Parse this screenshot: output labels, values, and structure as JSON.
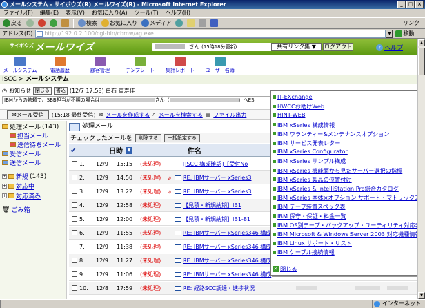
{
  "window": {
    "title": "メールシステム - サイボウズ(R) メールワイズ(R) - Microsoft Internet Explorer",
    "menus": [
      "ファイル(F)",
      "編集(E)",
      "表示(V)",
      "お気に入り(A)",
      "ツール(T)",
      "ヘルプ(H)"
    ],
    "toolbar": {
      "back": "戻る",
      "search": "検索",
      "favorites": "お気に入り",
      "media": "メディア"
    },
    "address_label": "アドレス(D)",
    "address_value": "http://192.0.2.100/cgi-bin/cbmw/ag.exe",
    "go_label": "移動",
    "links_label": "リンク"
  },
  "header": {
    "logo_small": "サイボウズ",
    "logo_big": "メールワイズ",
    "user_suffix": "さん",
    "user_note": "(15時18分更新)",
    "shared_links_button": "共有リンク集",
    "logout_button": "ログアウト",
    "help_link": "ヘルプ",
    "colors": {
      "band": "#6fa521",
      "link": "#0000cc"
    }
  },
  "apps": [
    {
      "label": "メールシステム",
      "color": "#4a78c8"
    },
    {
      "label": "電話履歴",
      "color": "#e07830"
    },
    {
      "label": "顧客管理",
      "color": "#8a5ab0"
    },
    {
      "label": "テンプレート",
      "color": "#7ab03a"
    },
    {
      "label": "集計レポート",
      "color": "#d04a4a"
    },
    {
      "label": "ユーザー名簿",
      "color": "#3a9ab0"
    }
  ],
  "breadcrumb": {
    "prefix": "ISCC",
    "separator": " > ",
    "current": "メールシステム"
  },
  "notice": {
    "label": "お知らせ",
    "close": "閉じる",
    "write": "書込",
    "meta": "(12/7 17:58) 白石 重寿佳",
    "body_start": "IBMからの依頼で、SBB担当が不明の場合は",
    "body_mid": "さん（",
    "body_end": "）へES"
  },
  "mail_toolbar": {
    "receive": "メール受信",
    "last_received": "(15:18 最終受信)",
    "create": "メールを作成する",
    "search": "メールを検索する",
    "export": "ファイル出力"
  },
  "sidebar": {
    "processing": "処理メール",
    "processing_count": "(143)",
    "assigned": "担当メール",
    "sending": "送信待ちメール",
    "received": "受信メール",
    "sent": "送信メール",
    "new": "新規",
    "new_count": "(143)",
    "in_progress": "対応中",
    "done": "対応済み",
    "trash": "ごみ箱"
  },
  "main": {
    "folder_title": "処理メール",
    "checked_label": "チェックしたメールを",
    "delete_button": "削除する",
    "bulk_button": "一括設定する",
    "col_date": "日時",
    "col_subject": "件名"
  },
  "rows": [
    {
      "num": "1.",
      "date": "12/9",
      "time": "15:15",
      "status": "(未処理)",
      "clip": false,
      "subject": "[ISCC 構成確認]【受付No"
    },
    {
      "num": "2.",
      "date": "12/9",
      "time": "14:50",
      "status": "(未処理)",
      "clip": true,
      "subject": "RE: IBMサーバー xSeries3"
    },
    {
      "num": "3.",
      "date": "12/9",
      "time": "13:22",
      "status": "(未処理)",
      "clip": true,
      "subject": "RE: IBMサーバー xSeries3"
    },
    {
      "num": "4.",
      "date": "12/9",
      "time": "12:58",
      "status": "(未処理)",
      "clip": false,
      "subject": "【見積・新規納期】IB1"
    },
    {
      "num": "5.",
      "date": "12/9",
      "time": "12:00",
      "status": "(未処理)",
      "clip": false,
      "subject": "【見積・新規納期】IB1-81"
    },
    {
      "num": "6.",
      "date": "12/9",
      "time": "11:55",
      "status": "(未処理)",
      "clip": false,
      "subject": "RE: IBMサーバー xSeries346 構成"
    },
    {
      "num": "7.",
      "date": "12/9",
      "time": "11:38",
      "status": "(未処理)",
      "clip": false,
      "subject": "RE: IBMサーバー xSeries346 構成"
    },
    {
      "num": "8.",
      "date": "12/9",
      "time": "11:27",
      "status": "(未処理)",
      "clip": false,
      "subject": "RE: IBMサーバー xSeries346 構成"
    },
    {
      "num": "9.",
      "date": "12/9",
      "time": "11:06",
      "status": "(未処理)",
      "clip": false,
      "subject": "RE: IBMサーバー xSeries346 構成"
    },
    {
      "num": "10.",
      "date": "12/8",
      "time": "17:59",
      "status": "(未処理)",
      "clip": false,
      "subject": "RE: 経路SCC調達・進捗状況"
    }
  ],
  "shared_links": {
    "items": [
      "IT-EXchange",
      "HWCCお助けWeb",
      "HINT-WEB",
      "IBM xSeries 構成情報",
      "IBM ワランティー&メンテナンスオプション",
      "IBM サービス発表レター",
      "IBM xSeries Configurator",
      "IBM xSeries サンプル構成",
      "IBM xSeries 機能面から見たサーバー選択の指標",
      "IBM xSeries 製品の位置付け",
      "IBM xSeries & IntelliStation Pro総合カタログ",
      "IBM xSeries 本体×オプション サポート・マトリックス",
      "IBM テープ装置スペック表",
      "IBM 保守・保証・料金一覧",
      "IBM OS別テープ・バックアップ・ユーティリティ対応表",
      "IBM Microsoft & Windows Server 2003 対応機種情報",
      "IBM Linux サポート・リスト",
      "IBM ケーブル接続情報"
    ],
    "close": "閉じる"
  },
  "statusbar": {
    "zone": "インターネット"
  }
}
